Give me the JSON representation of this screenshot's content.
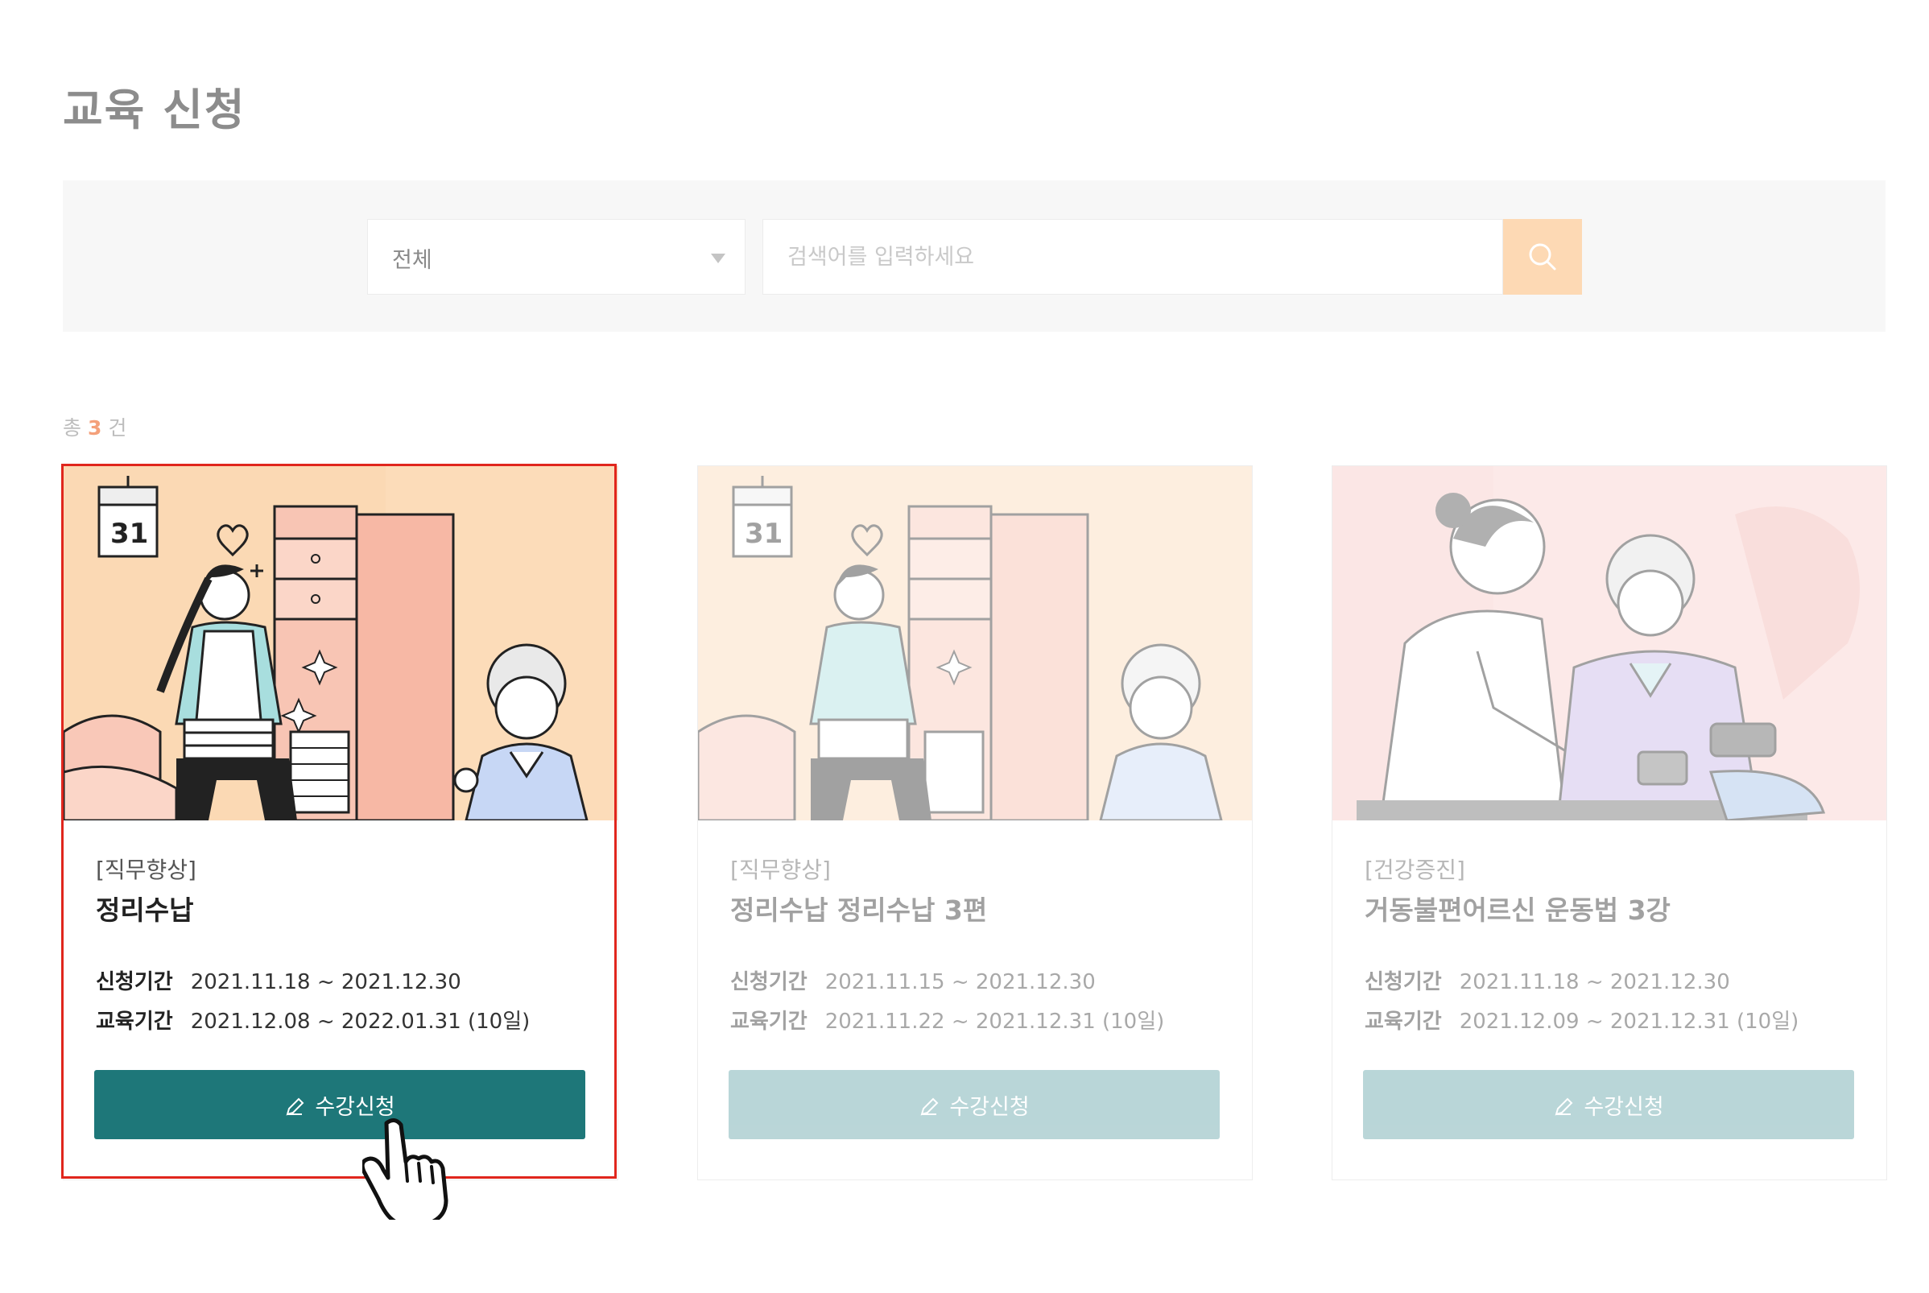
{
  "page": {
    "title": "교육 신청"
  },
  "search": {
    "category_selected": "전체",
    "placeholder": "검색어를 입력하세요",
    "button_icon": "search-icon",
    "button_color": "#fdd9b4"
  },
  "summary": {
    "prefix": "총",
    "count": "3",
    "suffix": "건"
  },
  "courses": [
    {
      "category": "[직무향상]",
      "title": "정리수납",
      "apply_label": "신청기간",
      "apply_period": "2021.11.18 ~ 2021.12.30",
      "edu_label": "교육기간",
      "edu_period": "2021.12.08 ~ 2022.01.31 (10일)",
      "button_label": "수강신청",
      "button_icon": "pencil-icon",
      "thumbnail": "caregiver-organizing-closet-illustration",
      "calendar_day": "31",
      "highlighted": true
    },
    {
      "category": "[직무향상]",
      "title": "정리수납 정리수납 3편",
      "apply_label": "신청기간",
      "apply_period": "2021.11.15 ~ 2021.12.30",
      "edu_label": "교육기간",
      "edu_period": "2021.11.22 ~ 2021.12.31 (10일)",
      "button_label": "수강신청",
      "button_icon": "pencil-icon",
      "thumbnail": "caregiver-organizing-closet-illustration",
      "calendar_day": "31",
      "highlighted": false
    },
    {
      "category": "[건강증진]",
      "title": "거동불편어르신 운동법 3강",
      "apply_label": "신청기간",
      "apply_period": "2021.11.18 ~ 2021.12.30",
      "edu_label": "교육기간",
      "edu_period": "2021.12.09 ~ 2021.12.31 (10일)",
      "button_label": "수강신청",
      "button_icon": "pencil-icon",
      "thumbnail": "doctor-checking-blood-pressure-illustration",
      "highlighted": false
    }
  ],
  "colors": {
    "accent_button": "#1e7779",
    "highlight_frame": "#e0261d",
    "count_number": "#f4a07a"
  }
}
